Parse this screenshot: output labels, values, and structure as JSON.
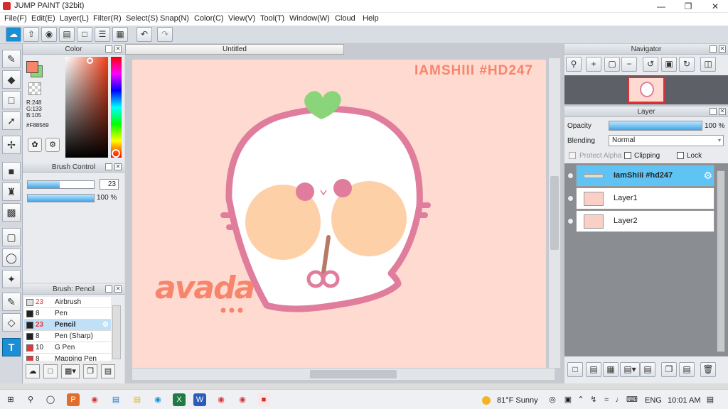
{
  "app": {
    "title": "JUMP PAINT (32bit)"
  },
  "menu": [
    "File(F)",
    "Edit(E)",
    "Layer(L)",
    "Filter(R)",
    "Select(S)",
    "Snap(N)",
    "Color(C)",
    "View(V)",
    "Tool(T)",
    "Window(W)",
    "Cloud",
    "Help"
  ],
  "toolbar_icons": [
    "cloud-upload-icon",
    "share-icon",
    "comment-icon",
    "comment-list-icon",
    "page-icon",
    "list-icon",
    "checklist-icon",
    "undo-icon",
    "redo-icon"
  ],
  "color_panel": {
    "title": "Color",
    "r": "R:248",
    "g": "G:133",
    "b": "B:105",
    "hex": "#F88569",
    "primary": "#F88569",
    "secondary": "#8ad57a"
  },
  "brush_control": {
    "title": "Brush Control",
    "size_value": "23",
    "size_fraction": 0.48,
    "opacity_value": "100 %",
    "opacity_fraction": 1.0
  },
  "brush_list": {
    "title": "Brush: Pencil",
    "items": [
      {
        "size": "23",
        "name": "Airbrush",
        "color": "#dddddd",
        "red": true,
        "selected": false
      },
      {
        "size": "8",
        "name": "Pen",
        "color": "#222222",
        "red": false,
        "selected": false
      },
      {
        "size": "23",
        "name": "Pencil",
        "color": "#222222",
        "red": true,
        "selected": true
      },
      {
        "size": "8",
        "name": "Pen (Sharp)",
        "color": "#222222",
        "red": false,
        "selected": false
      },
      {
        "size": "10",
        "name": "G Pen",
        "color": "#e23a3a",
        "red": false,
        "selected": false
      },
      {
        "size": "8",
        "name": "Mapping Pen",
        "color": "#e23a3a",
        "red": false,
        "selected": false
      }
    ]
  },
  "document": {
    "tab": "Untitled",
    "watermark": "IAMSHIII #HD247",
    "signature": "avada"
  },
  "navigator": {
    "title": "Navigator"
  },
  "layer_panel": {
    "title": "Layer",
    "opacity_label": "Opacity",
    "opacity_value": "100 %",
    "opacity_fraction": 1.0,
    "blending_label": "Blending",
    "blending_value": "Normal",
    "protect_alpha": "Protect Alpha",
    "clipping": "Clipping",
    "lock": "Lock",
    "layers": [
      {
        "name": "IamShiii #hd247",
        "selected": true
      },
      {
        "name": "Layer1",
        "selected": false
      },
      {
        "name": "Layer2",
        "selected": false
      }
    ]
  },
  "taskbar": {
    "weather": "81°F  Sunny",
    "lang": "ENG",
    "time": "10:01 AM"
  },
  "colors": {
    "accent": "#1b8fd6",
    "canvas_bg": "#fedad0",
    "outline": "#e07d9c",
    "cheek": "#fdd0a8",
    "leaf": "#8ad57a"
  }
}
